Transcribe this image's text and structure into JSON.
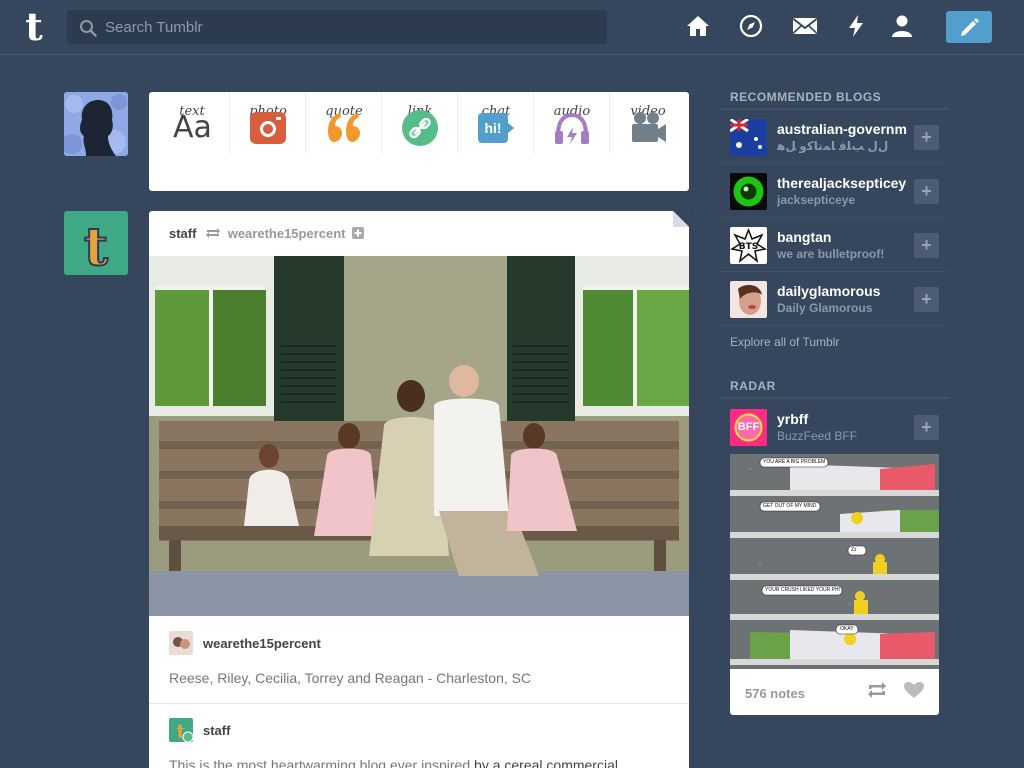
{
  "header": {
    "logo_letter": "t",
    "search_placeholder": "Search Tumblr",
    "nav": [
      "home-icon",
      "explore-compass-icon",
      "inbox-mail-icon",
      "activity-lightning-icon",
      "account-person-icon"
    ],
    "compose": "compose-pencil-icon"
  },
  "post_types": [
    {
      "label": "text",
      "icon": "Aa",
      "color": "#444444"
    },
    {
      "label": "photo",
      "icon": "camera",
      "color": "#d95e40"
    },
    {
      "label": "quote",
      "icon": "❝",
      "color": "#f2992e"
    },
    {
      "label": "link",
      "icon": "link",
      "color": "#56bc8a"
    },
    {
      "label": "chat",
      "icon": "hi!",
      "color": "#529ecc"
    },
    {
      "label": "audio",
      "icon": "headphones",
      "color": "#a77dc2"
    },
    {
      "label": "video",
      "icon": "video-camera",
      "color": "#748089"
    }
  ],
  "post": {
    "blog": "staff",
    "reblogged_from": "wearethe15percent",
    "source_blog": "wearethe15percent",
    "caption": "Reese, Riley, Cecilia, Torrey and Reagan - Charleston, SC",
    "second_blog": "staff",
    "body_text": "This is the most heartwarming blog ever inspired ",
    "body_link": "by a cereal commercial"
  },
  "sidebar": {
    "recommended_title": "RECOMMENDED BLOGS",
    "recommended": [
      {
        "name": "australian-governm",
        "sub": "ﻝﻝ ﺐﻠﻗ ﺎﻤﻧﺎﻛﻭ ﻞﻫ",
        "plus": "+"
      },
      {
        "name": "therealjacksepticeye",
        "sub": "jacksepticeye",
        "plus": "+"
      },
      {
        "name": "bangtan",
        "sub": "we are bulletproof!",
        "plus": "+"
      },
      {
        "name": "dailyglamorous",
        "sub": "Daily Glamorous",
        "plus": "+"
      }
    ],
    "explore": "Explore all of Tumblr",
    "radar_title": "RADAR",
    "radar": {
      "name": "yrbff",
      "sub": "BuzzFeed BFF",
      "plus": "+",
      "avatar_text": "BFF"
    },
    "comic_texts": [
      "YOU ARE A BIG PROBLEM",
      "GET OUT OF MY MIND",
      "Zz",
      "YOUR CRUSH LIKED YOUR PHOTO",
      "OKAY"
    ],
    "notes": "576 notes"
  }
}
